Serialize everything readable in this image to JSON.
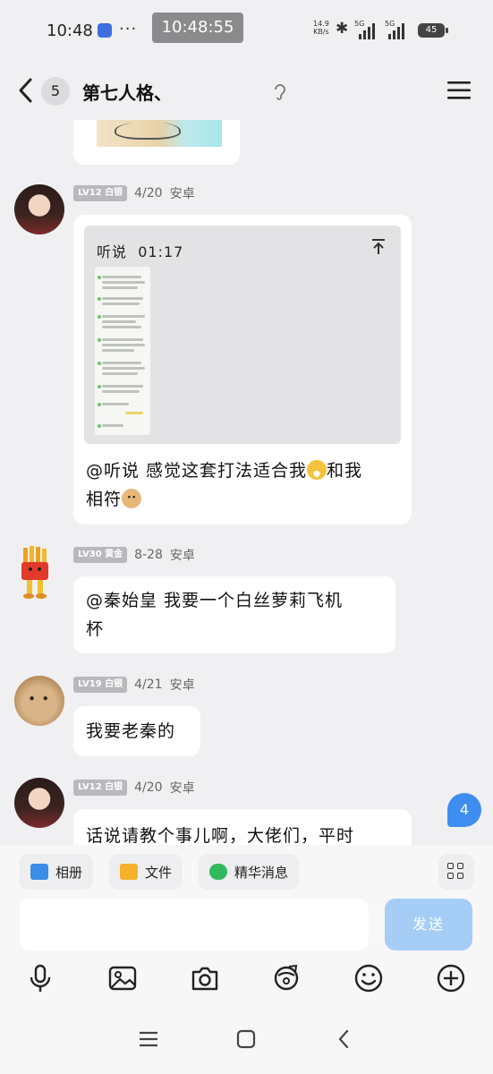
{
  "status_bar": {
    "time": "10:48",
    "dots": "···",
    "clock_overlay": "10:48:55",
    "net_speed_value": "14.9",
    "net_speed_unit": "KB/s",
    "sim1": "5G",
    "sim2": "5G",
    "battery": "45"
  },
  "header": {
    "unread_count": "5",
    "title": "第七人格、"
  },
  "messages": [
    {
      "level": "LV12",
      "rank": "白银",
      "date": "4/20",
      "device": "安卓",
      "file": {
        "title": "听说",
        "time": "01:17"
      },
      "text_line1": "@听说 感觉这套打法适合我",
      "text_mid": "和我",
      "text_line2": "相符"
    },
    {
      "level": "LV30",
      "rank": "黄金",
      "date": "8-28",
      "device": "安卓",
      "text_line1": "@秦始皇 我要一个白丝萝莉飞机",
      "text_line2": "杯"
    },
    {
      "level": "LV19",
      "rank": "白银",
      "date": "4/21",
      "device": "安卓",
      "text_line1": "我要老秦的"
    },
    {
      "level": "LV12",
      "rank": "白银",
      "date": "4/20",
      "device": "安卓",
      "text_line1": "话说请教个事儿啊，大佬们，平时"
    }
  ],
  "new_message_badge": "4",
  "chips": {
    "album": "相册",
    "file": "文件",
    "highlights": "精华消息"
  },
  "composer": {
    "send_label": "发送"
  },
  "colors": {
    "accent": "#3d8ef0",
    "send_disabled": "#a6cdf6",
    "background": "#f0f0f2"
  }
}
